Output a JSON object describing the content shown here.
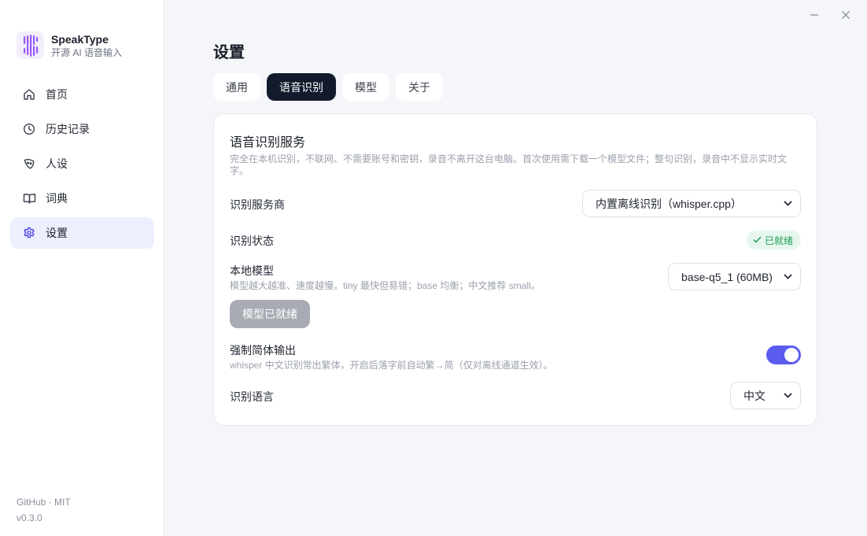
{
  "window": {
    "minimize_icon": "minimize-icon",
    "close_icon": "close-icon"
  },
  "brand": {
    "name": "SpeakType",
    "subtitle": "开源 AI 语音输入",
    "logo_icon": "s-logo-icon"
  },
  "sidebar": {
    "items": [
      {
        "label": "首页",
        "icon": "home-icon"
      },
      {
        "label": "历史记录",
        "icon": "clock-icon"
      },
      {
        "label": "人设",
        "icon": "persona-icon"
      },
      {
        "label": "词典",
        "icon": "book-icon"
      },
      {
        "label": "设置",
        "icon": "gear-icon",
        "active": true
      }
    ],
    "footer": {
      "links": "GitHub · MIT",
      "version": "v0.3.0"
    }
  },
  "main": {
    "title": "设置",
    "tabs": [
      {
        "label": "通用"
      },
      {
        "label": "语音识别",
        "active": true
      },
      {
        "label": "模型"
      },
      {
        "label": "关于"
      }
    ],
    "card": {
      "title": "语音识别服务",
      "description": "完全在本机识别，不联网、不需要账号和密钥，录音不离开这台电脑。首次使用需下载一个模型文件；整句识别，录音中不显示实时文字。",
      "provider": {
        "label": "识别服务商",
        "value": "内置离线识别（whisper.cpp）"
      },
      "status": {
        "label": "识别状态",
        "badge": "已就绪",
        "color": "#1f9d55"
      },
      "local_model": {
        "label": "本地模型",
        "hint": "模型越大越准、速度越慢。tiny 最快但易错；base 均衡；中文推荐 small。",
        "value": "base-q5_1 (60MB)",
        "button": "模型已就绪"
      },
      "simplified": {
        "label": "强制简体输出",
        "hint": "whisper 中文识别常出繁体，开启后落字前自动繁→简（仅对离线通道生效）。",
        "enabled": true,
        "accent": "#5b5cf0"
      },
      "language": {
        "label": "识别语言",
        "value": "中文"
      }
    }
  }
}
